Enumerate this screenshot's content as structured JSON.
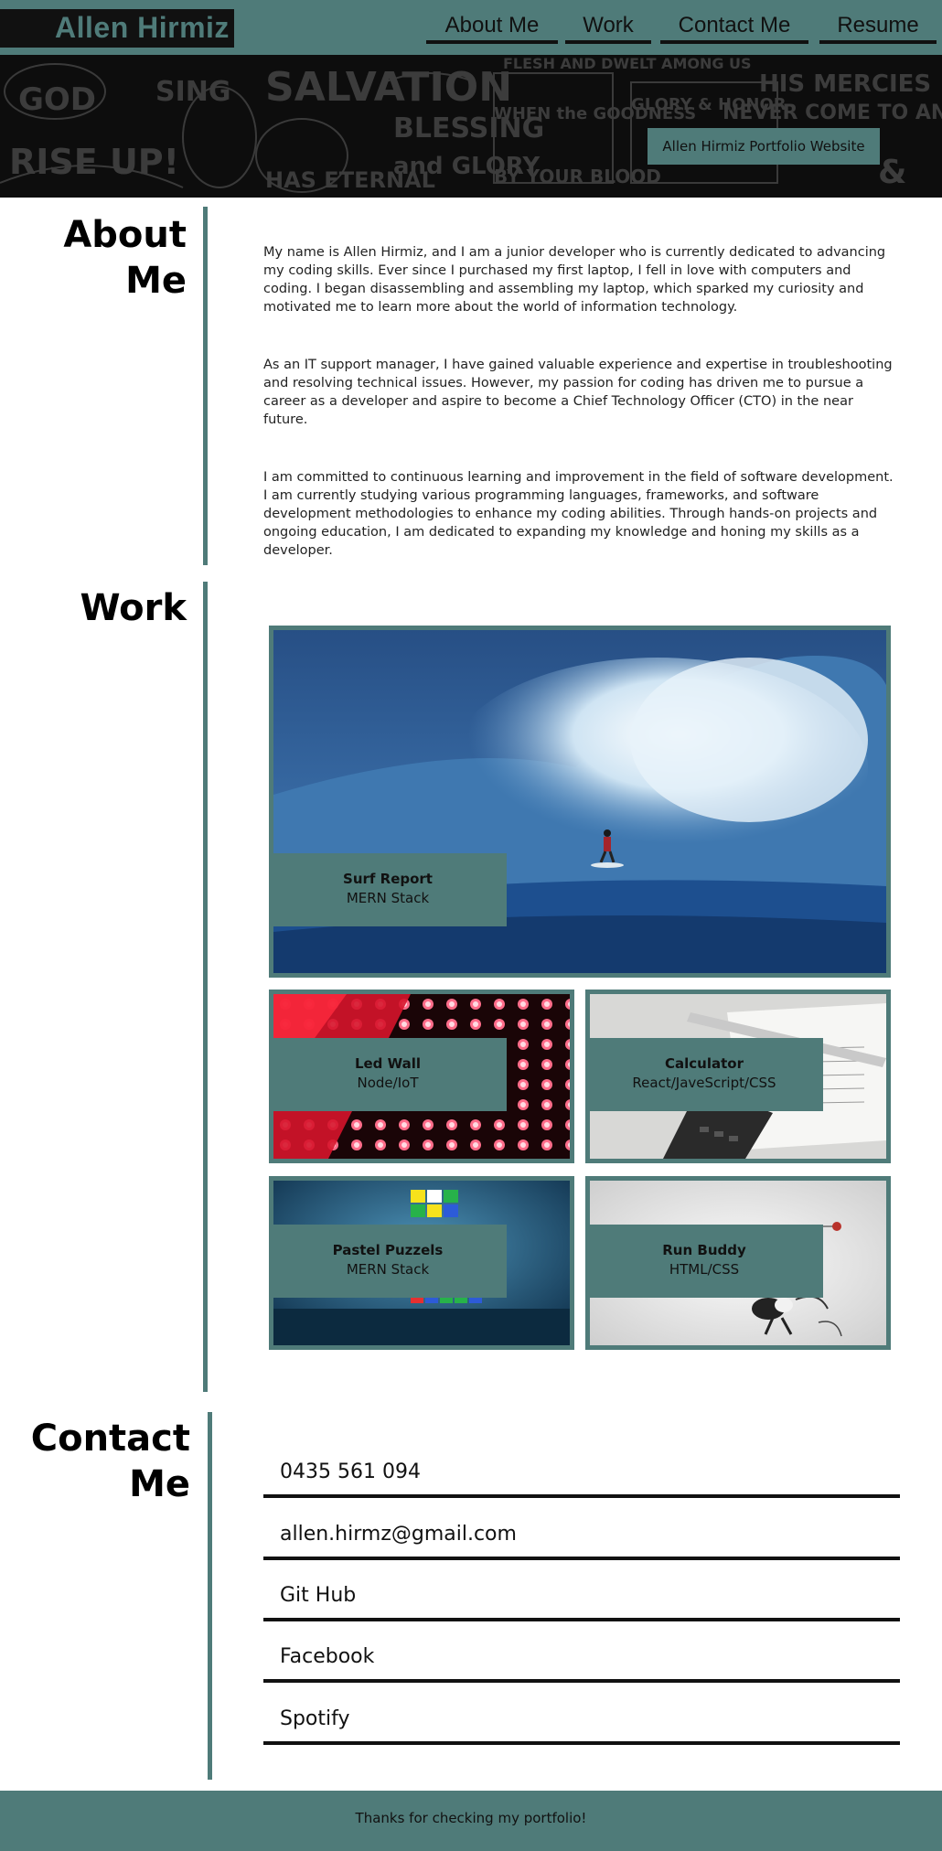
{
  "header": {
    "brand": "Allen Hirmiz",
    "nav": [
      {
        "label": "About Me"
      },
      {
        "label": "Work"
      },
      {
        "label": "Contact Me"
      },
      {
        "label": "Resume"
      }
    ],
    "banner_badge": "Allen Hirmiz Portfolio Website"
  },
  "about": {
    "title_line1": "About",
    "title_line2": "Me",
    "paragraphs": [
      "My name is Allen Hirmiz, and I am a junior developer who is currently dedicated to advancing my coding skills. Ever since I purchased my first laptop, I fell in love with computers and coding. I began disassembling and assembling my laptop, which sparked my curiosity and motivated me to learn more about the world of information technology.",
      "As an IT support manager, I have gained valuable experience and expertise in troubleshooting and resolving technical issues. However, my passion for coding has driven me to pursue a career as a developer and aspire to become a Chief Technology Officer (CTO) in the near future.",
      "I am committed to continuous learning and improvement in the field of software development. I am currently studying various programming languages, frameworks, and software development methodologies to enhance my coding abilities. Through hands-on projects and ongoing education, I am dedicated to expanding my knowledge and honing my skills as a developer."
    ]
  },
  "work": {
    "title": "Work",
    "projects": [
      {
        "title": "Surf Report",
        "stack": "MERN Stack"
      },
      {
        "title": "Led Wall",
        "stack": "Node/IoT"
      },
      {
        "title": "Calculator",
        "stack": "React/JaveScript/CSS"
      },
      {
        "title": "Pastel Puzzels",
        "stack": "MERN Stack"
      },
      {
        "title": "Run Buddy",
        "stack": "HTML/CSS"
      }
    ]
  },
  "contact": {
    "title_line1": "Contact",
    "title_line2": "Me",
    "items": [
      {
        "label": "0435 561 094"
      },
      {
        "label": "allen.hirmz@gmail.com"
      },
      {
        "label": "Git Hub"
      },
      {
        "label": "Facebook"
      },
      {
        "label": "Spotify"
      }
    ]
  },
  "footer": {
    "text": "Thanks for checking my portfolio!"
  },
  "colors": {
    "accent": "#4f7b79",
    "text": "#111111"
  }
}
